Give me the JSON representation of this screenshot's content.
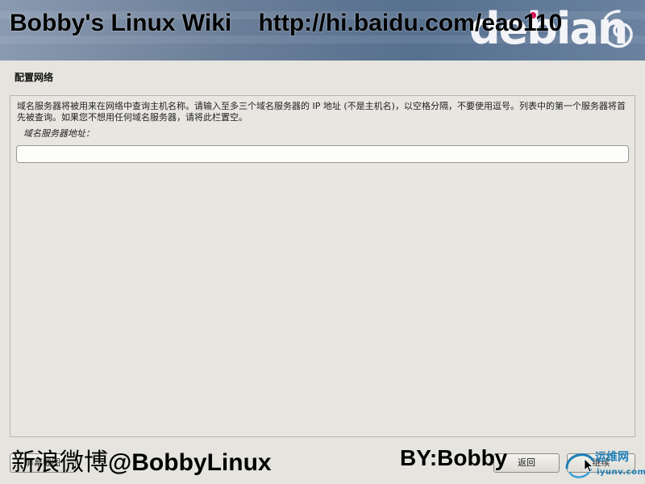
{
  "banner": {
    "watermark_text": "Bobby's Linux Wiki    http://hi.baidu.com/eao110",
    "brand_word": "debian",
    "brand_icon": "debian-swirl-icon",
    "colors": {
      "banner": "#6b7f99",
      "brand_dot": "#d70a53",
      "brand_text": "#f3f4f7"
    }
  },
  "section": {
    "title": "配置网络"
  },
  "form": {
    "help_text": "域名服务器将被用来在网络中查询主机名称。请输入至多三个域名服务器的 IP 地址 (不是主机名)，以空格分隔，不要使用逗号。列表中的第一个服务器将首先被查询。如果您不想用任何域名服务器，请将此栏置空。",
    "field_label": "域名服务器地址：",
    "field_value": "",
    "field_placeholder": ""
  },
  "buttons": {
    "screenshot": "屏幕截图",
    "back": "返回",
    "continue": "继续"
  },
  "watermarks": {
    "weibo_cn": "新浪微博",
    "weibo_handle": "@BobbyLinux",
    "by": "BY:Bobby",
    "site_name": "运维网",
    "site_domain": "iyunv.com",
    "site_color": "#1e7fb8"
  }
}
